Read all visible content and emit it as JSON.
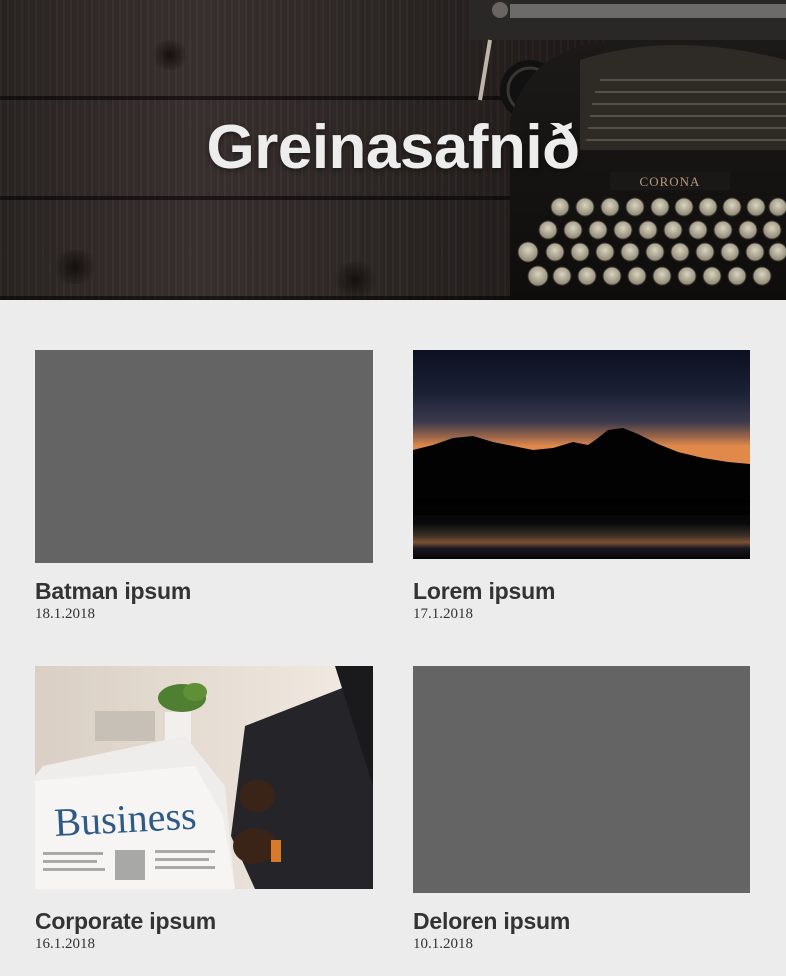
{
  "header": {
    "title": "Greinasafnið"
  },
  "articles": [
    {
      "title": "Batman ipsum",
      "date": "18.1.2018",
      "image": "placeholder"
    },
    {
      "title": "Lorem ipsum",
      "date": "17.1.2018",
      "image": "mountain-sunset"
    },
    {
      "title": "Corporate ipsum",
      "date": "16.1.2018",
      "image": "business-newspaper"
    },
    {
      "title": "Deloren ipsum",
      "date": "10.1.2018",
      "image": "placeholder"
    }
  ],
  "colors": {
    "page_background": "#ececec",
    "placeholder": "#646464",
    "text": "#333333",
    "hero_title": "#ededed"
  }
}
